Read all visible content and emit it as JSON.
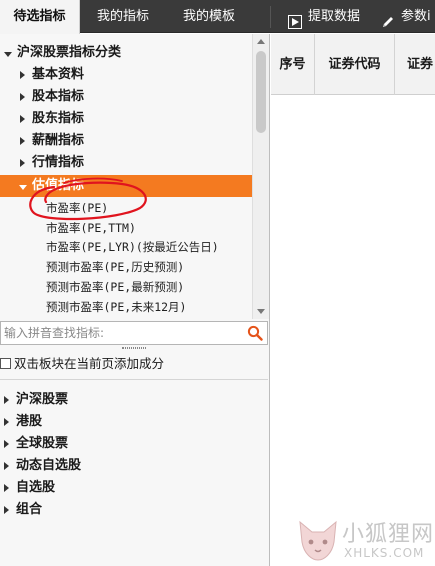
{
  "tabs": [
    {
      "label": "待选指标",
      "active": true
    },
    {
      "label": "我的指标",
      "active": false
    },
    {
      "label": "我的模板",
      "active": false
    }
  ],
  "toolbar": {
    "extract_label": "提取数据",
    "params_label": "参数i"
  },
  "tree": {
    "root": "沪深股票指标分类",
    "categories": [
      "基本资料",
      "股本指标",
      "股东指标",
      "薪酬指标",
      "行情指标"
    ],
    "expanded": "估值指标",
    "items": [
      "市盈率(PE)",
      "市盈率(PE,TTM)",
      "市盈率(PE,LYR)(按最近公告日)",
      "预测市盈率(PE,历史预测)",
      "预测市盈率(PE,最新预测)",
      "预测市盈率(PE,未来12月)"
    ]
  },
  "search": {
    "placeholder": "输入拼音查找指标:"
  },
  "checkbox_label": "双击板块在当前页添加成分",
  "tree2": [
    "沪深股票",
    "港股",
    "全球股票",
    "动态自选股",
    "自选股",
    "组合"
  ],
  "table": {
    "headers": [
      "序号",
      "证券代码",
      "证券"
    ]
  },
  "watermark": {
    "cn": "小狐狸网",
    "en": "XHLKS.COM"
  },
  "colors": {
    "highlight": "#f47a20",
    "annotation": "#e0141e",
    "tabbar": "#3a3a3a"
  }
}
